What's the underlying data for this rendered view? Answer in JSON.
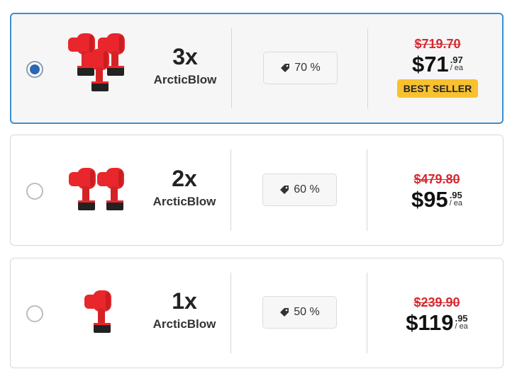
{
  "options": [
    {
      "selected": true,
      "quantity": "3x",
      "brand": "ArcticBlow",
      "discount": "70 %",
      "old_price": "$719.70",
      "price_main": "$71",
      "price_cents": ".97",
      "price_unit": "/ ea",
      "badge": "BEST SELLER",
      "image_icon": "cordless-blower-3-pack-icon"
    },
    {
      "selected": false,
      "quantity": "2x",
      "brand": "ArcticBlow",
      "discount": "60 %",
      "old_price": "$479.80",
      "price_main": "$95",
      "price_cents": ".95",
      "price_unit": "/ ea",
      "image_icon": "cordless-blower-2-pack-icon"
    },
    {
      "selected": false,
      "quantity": "1x",
      "brand": "ArcticBlow",
      "discount": "50 %",
      "old_price": "$239.90",
      "price_main": "$119",
      "price_cents": ".95",
      "price_unit": "/ ea",
      "image_icon": "cordless-blower-icon"
    }
  ],
  "colors": {
    "selected_border": "#3b8fd4",
    "old_price": "#d7282f",
    "badge_bg": "#f7c12f",
    "product_red": "#e8262b"
  },
  "icons": {
    "discount": "tag-icon"
  }
}
